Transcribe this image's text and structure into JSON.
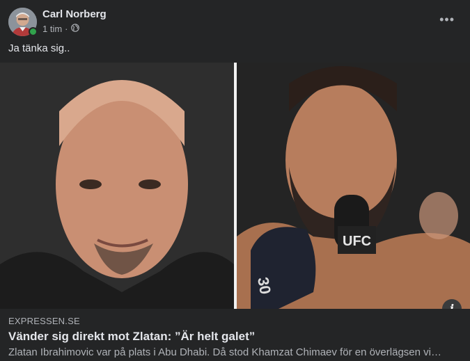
{
  "post": {
    "author": "Carl Norberg",
    "time": "1 tim",
    "separator": "·",
    "privacy_icon": "globe-icon",
    "more_icon": "more-options-icon",
    "more_label": "•••",
    "text": "Ja tänka sig.."
  },
  "link": {
    "domain": "EXPRESSEN.SE",
    "title": "Vänder sig direkt mot Zlatan: ”Är helt galet”",
    "description": "Zlatan Ibrahimovic var på plats i Abu Dhabi. Då stod Khamzat Chimaev för en överlägsen vinst i...",
    "info_label": "i"
  },
  "media": {
    "microphone_logo": "UFC",
    "glove_number": "30"
  },
  "colors": {
    "background": "#242526",
    "online": "#31a24c",
    "secondary_text": "#b0b3b8"
  }
}
